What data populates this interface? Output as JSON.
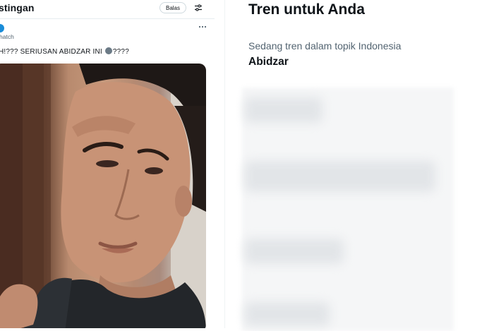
{
  "left": {
    "title_fragment": "stingan",
    "reply_label": "Balas",
    "handle_fragment": "hatch",
    "post_text_before": "H!??? SERIUSAN ABIDZAR INI",
    "post_text_after": "????",
    "icons": {
      "filter": "sliders-icon",
      "more": "more-horizontal-icon",
      "emoji": "emoji-icon"
    }
  },
  "right": {
    "title": "Tren untuk Anda",
    "trend_context": "Sedang tren dalam topik Indonesia",
    "trend_name": "Abidzar"
  },
  "colors": {
    "text_primary": "#0f1419",
    "text_secondary": "#536471",
    "border": "#cfd9de"
  }
}
